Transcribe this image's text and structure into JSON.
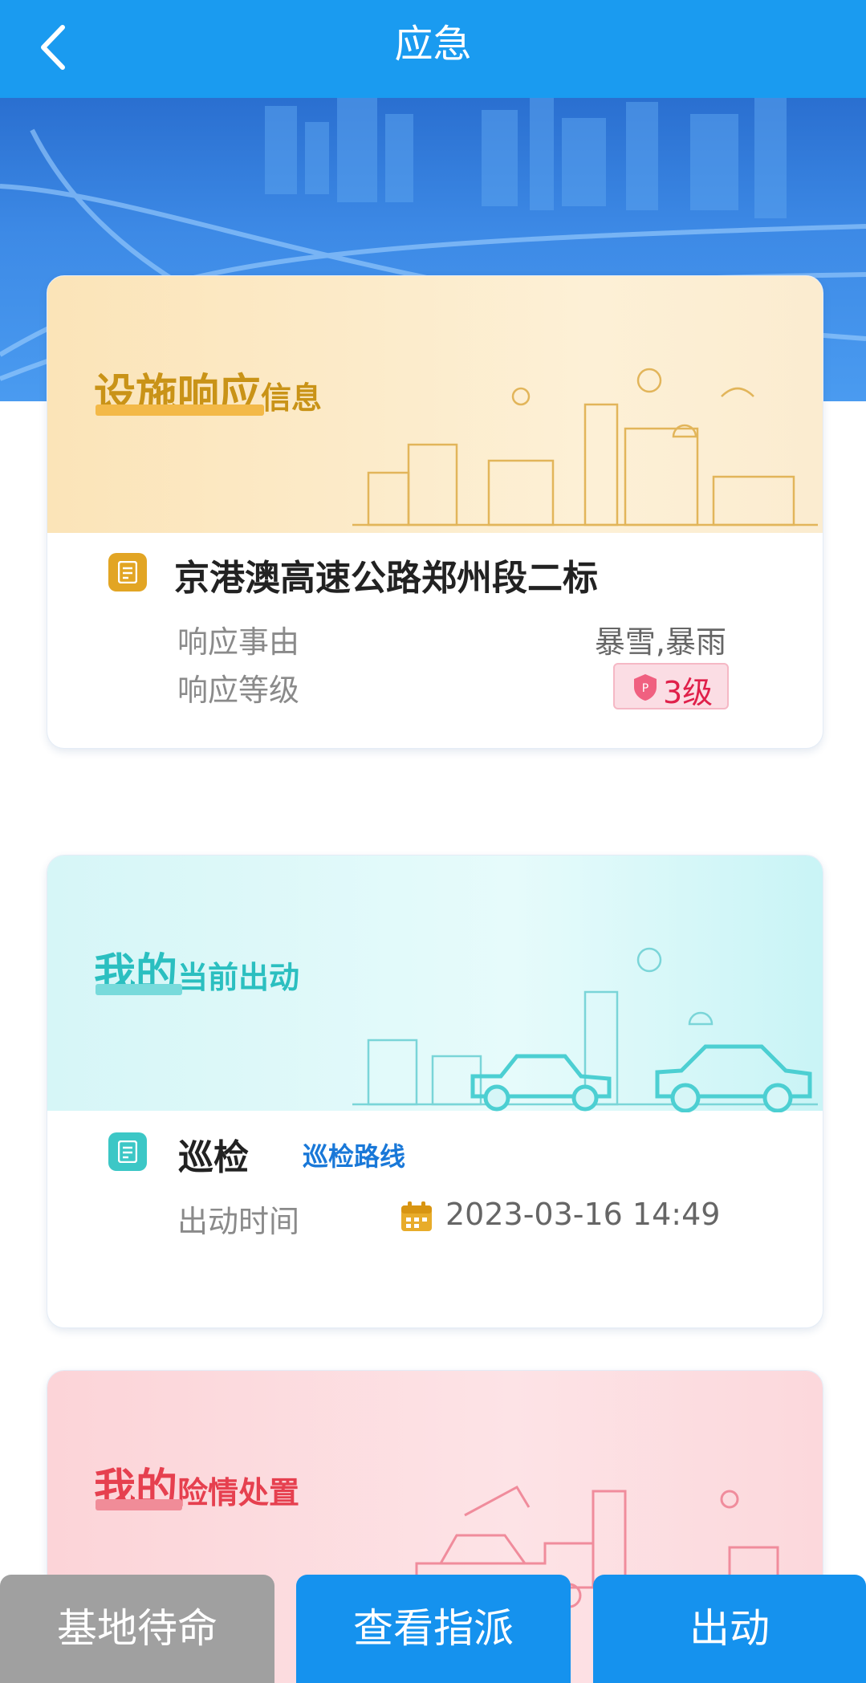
{
  "header": {
    "title": "应急",
    "back_icon": "chevron-left-icon"
  },
  "cards": {
    "facility": {
      "title_big": "设施响应",
      "title_small": "信息",
      "project_name": "京港澳高速公路郑州段二标",
      "reason_label": "响应事由",
      "reason_value": "暴雪,暴雨",
      "level_label": "响应等级",
      "level_value": "3级",
      "accent": "#c99317"
    },
    "dispatch": {
      "title_big": "我的",
      "title_small": "当前出动",
      "task_name": "巡检",
      "route_link": "巡检路线",
      "time_label": "出动时间",
      "time_value": "2023-03-16 14:49",
      "accent": "#2bbfc0"
    },
    "hazard": {
      "title_big": "我的",
      "title_small": "险情处置",
      "accent": "#e6404f"
    }
  },
  "actions": {
    "standby_label": "基地待命",
    "view_assign_label": "查看指派",
    "dispatch_label": "出动"
  },
  "colors": {
    "primary": "#1a9bf0",
    "button_blue": "#1592ee",
    "button_gray": "#a0a0a0",
    "level_red": "#e0204a"
  }
}
